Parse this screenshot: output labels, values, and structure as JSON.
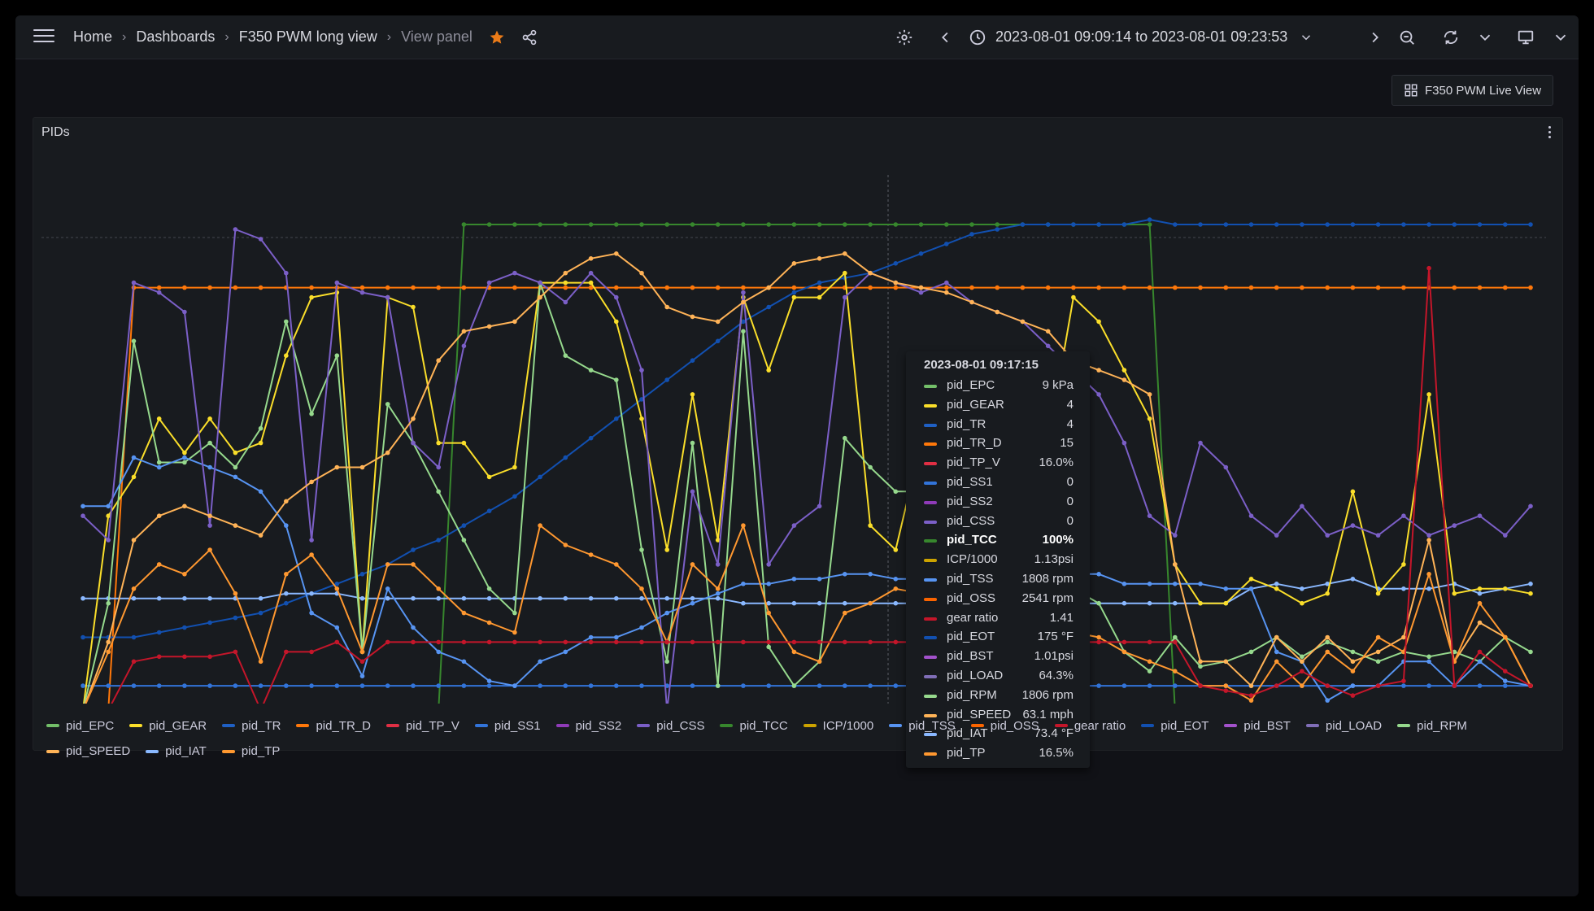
{
  "breadcrumb": [
    "Home",
    "Dashboards",
    "F350 PWM long view",
    "View panel"
  ],
  "time_range": "2023-08-01 09:09:14 to 2023-08-01 09:23:53",
  "link_button": "F350 PWM Live View",
  "panel": {
    "title": "PIDs"
  },
  "icons": {
    "menu": "hamburger-menu-icon",
    "star": "star-icon",
    "share": "share-icon",
    "settings": "gear-icon",
    "prev": "chevron-left-icon",
    "clock": "clock-icon",
    "next": "chevron-right-icon",
    "zoom_out": "zoom-out-icon",
    "refresh": "refresh-icon",
    "view_mode": "monitor-icon",
    "panel_menu": "kebab-menu-icon",
    "dashboard": "dashboard-grid-icon"
  },
  "colors": {
    "favorite": "#eb7b18",
    "background": "#111217",
    "panel": "#181b1f"
  },
  "tooltip": {
    "time": "2023-08-01 09:17:15",
    "rows": [
      {
        "name": "pid_EPC",
        "value": "9 kPa",
        "color": "#73bf69"
      },
      {
        "name": "pid_GEAR",
        "value": "4",
        "color": "#fade2a"
      },
      {
        "name": "pid_TR",
        "value": "4",
        "color": "#1f60c4"
      },
      {
        "name": "pid_TR_D",
        "value": "15",
        "color": "#ff780a"
      },
      {
        "name": "pid_TP_V",
        "value": "16.0%",
        "color": "#e02f44"
      },
      {
        "name": "pid_SS1",
        "value": "0",
        "color": "#3274d9"
      },
      {
        "name": "pid_SS2",
        "value": "0",
        "color": "#8f3bb8"
      },
      {
        "name": "pid_CSS",
        "value": "0",
        "color": "#7b5fc7"
      },
      {
        "name": "pid_TCC",
        "value": "100%",
        "color": "#37872d",
        "bold": true
      },
      {
        "name": "ICP/1000",
        "value": "1.13psi",
        "color": "#cca300"
      },
      {
        "name": "pid_TSS",
        "value": "1808 rpm",
        "color": "#5794f2"
      },
      {
        "name": "pid_OSS",
        "value": "2541 rpm",
        "color": "#fa6400"
      },
      {
        "name": "gear ratio",
        "value": "1.41",
        "color": "#c4162a"
      },
      {
        "name": "pid_EOT",
        "value": "175 °F",
        "color": "#1250b0"
      },
      {
        "name": "pid_BST",
        "value": "1.01psi",
        "color": "#a352cc"
      },
      {
        "name": "pid_LOAD",
        "value": "64.3%",
        "color": "#806eb7"
      },
      {
        "name": "pid_RPM",
        "value": "1806 rpm",
        "color": "#96d98d"
      },
      {
        "name": "pid_SPEED",
        "value": "63.1 mph",
        "color": "#ffb357"
      },
      {
        "name": "pid_IAT",
        "value": "73.4 °F",
        "color": "#8ab8ff"
      },
      {
        "name": "pid_TP",
        "value": "16.5%",
        "color": "#ff9830"
      }
    ]
  },
  "legend": [
    {
      "name": "pid_EPC",
      "color": "#73bf69"
    },
    {
      "name": "pid_GEAR",
      "color": "#fade2a"
    },
    {
      "name": "pid_TR",
      "color": "#1f60c4"
    },
    {
      "name": "pid_TR_D",
      "color": "#ff780a"
    },
    {
      "name": "pid_TP_V",
      "color": "#e02f44"
    },
    {
      "name": "pid_SS1",
      "color": "#3274d9"
    },
    {
      "name": "pid_SS2",
      "color": "#8f3bb8"
    },
    {
      "name": "pid_CSS",
      "color": "#7b5fc7"
    },
    {
      "name": "pid_TCC",
      "color": "#37872d"
    },
    {
      "name": "ICP/1000",
      "color": "#cca300"
    },
    {
      "name": "pid_TSS",
      "color": "#5794f2"
    },
    {
      "name": "pid_OSS",
      "color": "#fa6400"
    },
    {
      "name": "gear ratio",
      "color": "#c4162a"
    },
    {
      "name": "pid_EOT",
      "color": "#1250b0"
    },
    {
      "name": "pid_BST",
      "color": "#a352cc"
    },
    {
      "name": "pid_LOAD",
      "color": "#806eb7"
    },
    {
      "name": "pid_RPM",
      "color": "#96d98d"
    },
    {
      "name": "pid_SPEED",
      "color": "#ffb357"
    },
    {
      "name": "pid_IAT",
      "color": "#8ab8ff"
    },
    {
      "name": "pid_TP",
      "color": "#ff9830"
    }
  ],
  "chart_data": {
    "type": "line",
    "title": "PIDs",
    "x_time_range": [
      "2023-08-01 09:09:14",
      "2023-08-01 09:23:53"
    ],
    "ylim": [
      0,
      1
    ],
    "grid": false,
    "legend_position": "bottom",
    "hover_time": "2023-08-01 09:17:15",
    "series": [
      {
        "name": "pid_TCC",
        "color": "#37872d",
        "values": [
          0,
          0,
          0,
          0,
          0,
          0,
          0,
          0,
          0,
          0,
          0,
          0,
          0,
          0,
          0,
          1,
          1,
          1,
          1,
          1,
          1,
          1,
          1,
          1,
          1,
          1,
          1,
          1,
          1,
          1,
          1,
          1,
          1,
          1,
          1,
          1,
          1,
          1,
          1,
          1,
          1,
          1,
          1,
          0,
          0,
          0,
          0,
          0,
          0,
          0,
          0,
          0,
          0,
          0,
          0,
          0,
          0,
          0
        ]
      },
      {
        "name": "pid_TR_D",
        "color": "#ff780a",
        "values": [
          0,
          0,
          0.87,
          0.87,
          0.87,
          0.87,
          0.87,
          0.87,
          0.87,
          0.87,
          0.87,
          0.87,
          0.87,
          0.87,
          0.87,
          0.87,
          0.87,
          0.87,
          0.87,
          0.87,
          0.87,
          0.87,
          0.87,
          0.87,
          0.87,
          0.87,
          0.87,
          0.87,
          0.87,
          0.87,
          0.87,
          0.87,
          0.87,
          0.87,
          0.87,
          0.87,
          0.87,
          0.87,
          0.87,
          0.87,
          0.87,
          0.87,
          0.87,
          0.87,
          0.87,
          0.87,
          0.87,
          0.87,
          0.87,
          0.87,
          0.87,
          0.87,
          0.87,
          0.87,
          0.87,
          0.87,
          0.87,
          0.87
        ]
      },
      {
        "name": "pid_EOT",
        "color": "#1250b0",
        "values": [
          0.15,
          0.15,
          0.15,
          0.16,
          0.17,
          0.18,
          0.19,
          0.2,
          0.22,
          0.24,
          0.26,
          0.28,
          0.3,
          0.33,
          0.35,
          0.38,
          0.41,
          0.44,
          0.48,
          0.52,
          0.56,
          0.6,
          0.64,
          0.68,
          0.72,
          0.76,
          0.8,
          0.83,
          0.86,
          0.88,
          0.89,
          0.9,
          0.92,
          0.94,
          0.96,
          0.98,
          0.99,
          1,
          1,
          1,
          1,
          1,
          1.01,
          1,
          1,
          1,
          1,
          1,
          1,
          1,
          1,
          1,
          1,
          1,
          1,
          1,
          1,
          1
        ]
      },
      {
        "name": "pid_SS1",
        "color": "#3274d9",
        "values": [
          0.05,
          0.05,
          0.05,
          0.05,
          0.05,
          0.05,
          0.05,
          0.05,
          0.05,
          0.05,
          0.05,
          0.05,
          0.05,
          0.05,
          0.05,
          0.05,
          0.05,
          0.05,
          0.05,
          0.05,
          0.05,
          0.05,
          0.05,
          0.05,
          0.05,
          0.05,
          0.05,
          0.05,
          0.05,
          0.05,
          0.05,
          0.05,
          0.05,
          0.05,
          0.05,
          0.05,
          0.05,
          0.05,
          0.05,
          0.05,
          0.05,
          0.05,
          0.05,
          0.05,
          0.05,
          0.05,
          0.05,
          0.05,
          0.05,
          0.05,
          0.05,
          0.05,
          0.05,
          0.05,
          0.05,
          0.05,
          0.05,
          0.05
        ]
      },
      {
        "name": "pid_IAT",
        "color": "#8ab8ff",
        "values": [
          0.23,
          0.23,
          0.23,
          0.23,
          0.23,
          0.23,
          0.23,
          0.23,
          0.24,
          0.24,
          0.24,
          0.23,
          0.23,
          0.23,
          0.23,
          0.23,
          0.23,
          0.23,
          0.23,
          0.23,
          0.23,
          0.23,
          0.23,
          0.23,
          0.23,
          0.23,
          0.22,
          0.22,
          0.22,
          0.22,
          0.22,
          0.22,
          0.22,
          0.22,
          0.22,
          0.22,
          0.22,
          0.22,
          0.22,
          0.22,
          0.22,
          0.22,
          0.22,
          0.22,
          0.22,
          0.22,
          0.25,
          0.26,
          0.25,
          0.26,
          0.27,
          0.25,
          0.25,
          0.25,
          0.26,
          0.24,
          0.25,
          0.26
        ]
      },
      {
        "name": "pid_GEAR",
        "color": "#fade2a",
        "values": [
          0,
          0.4,
          0.48,
          0.6,
          0.53,
          0.6,
          0.53,
          0.55,
          0.73,
          0.85,
          0.86,
          0.12,
          0.85,
          0.83,
          0.55,
          0.55,
          0.48,
          0.5,
          0.88,
          0.88,
          0.88,
          0.8,
          0.6,
          0.33,
          0.65,
          0.35,
          0.85,
          0.7,
          0.85,
          0.85,
          0.9,
          0.38,
          0.33,
          0.55,
          0.5,
          0.6,
          0.5,
          0.5,
          0.55,
          0.85,
          0.8,
          0.7,
          0.6,
          0.3,
          0.22,
          0.22,
          0.27,
          0.25,
          0.22,
          0.24,
          0.45,
          0.24,
          0.3,
          0.65,
          0.24,
          0.25,
          0.25,
          0.24
        ]
      },
      {
        "name": "pid_RPM",
        "color": "#96d98d",
        "values": [
          0,
          0.22,
          0.76,
          0.51,
          0.51,
          0.55,
          0.5,
          0.58,
          0.8,
          0.61,
          0.73,
          0.12,
          0.63,
          0.55,
          0.45,
          0.35,
          0.25,
          0.2,
          0.88,
          0.73,
          0.7,
          0.68,
          0.33,
          0.1,
          0.55,
          0.05,
          0.78,
          0.13,
          0.05,
          0.1,
          0.56,
          0.5,
          0.45,
          0.45,
          0.4,
          0.38,
          0.38,
          0.32,
          0.28,
          0.25,
          0.22,
          0.12,
          0.08,
          0.15,
          0.09,
          0.1,
          0.12,
          0.15,
          0.11,
          0.14,
          0.12,
          0.1,
          0.12,
          0.11,
          0.12,
          0.1,
          0.15,
          0.12
        ]
      },
      {
        "name": "pid_TSS",
        "color": "#5794f2",
        "values": [
          0.42,
          0.42,
          0.52,
          0.5,
          0.52,
          0.5,
          0.48,
          0.45,
          0.38,
          0.2,
          0.17,
          0.07,
          0.25,
          0.17,
          0.12,
          0.1,
          0.06,
          0.05,
          0.1,
          0.12,
          0.15,
          0.15,
          0.17,
          0.2,
          0.22,
          0.24,
          0.26,
          0.26,
          0.27,
          0.27,
          0.28,
          0.28,
          0.27,
          0.27,
          0.27,
          0.27,
          0.27,
          0.28,
          0.28,
          0.28,
          0.28,
          0.26,
          0.26,
          0.26,
          0.26,
          0.25,
          0.25,
          0.12,
          0.1,
          0.02,
          0.05,
          0.05,
          0.1,
          0.1,
          0.05,
          0.1,
          0.06,
          0.05
        ]
      },
      {
        "name": "pid_LOAD",
        "color": "#7b5fc7",
        "values": [
          0.4,
          0.35,
          0.88,
          0.86,
          0.82,
          0.38,
          0.99,
          0.97,
          0.9,
          0.35,
          0.88,
          0.86,
          0.85,
          0.55,
          0.5,
          0.75,
          0.88,
          0.9,
          0.88,
          0.84,
          0.9,
          0.85,
          0.7,
          0,
          0.45,
          0.3,
          0.86,
          0.3,
          0.38,
          0.42,
          0.85,
          0.9,
          0.88,
          0.86,
          0.88,
          0.84,
          0.82,
          0.8,
          0.75,
          0.7,
          0.65,
          0.55,
          0.4,
          0.36,
          0.55,
          0.5,
          0.4,
          0.36,
          0.42,
          0.36,
          0.38,
          0.36,
          0.4,
          0.36,
          0.38,
          0.4,
          0.36,
          0.42
        ]
      },
      {
        "name": "pid_SPEED",
        "color": "#ffb357",
        "values": [
          0,
          0.14,
          0.35,
          0.4,
          0.42,
          0.4,
          0.38,
          0.36,
          0.43,
          0.47,
          0.5,
          0.5,
          0.53,
          0.6,
          0.72,
          0.78,
          0.79,
          0.8,
          0.85,
          0.9,
          0.93,
          0.94,
          0.9,
          0.83,
          0.81,
          0.8,
          0.84,
          0.87,
          0.92,
          0.93,
          0.94,
          0.9,
          0.88,
          0.87,
          0.86,
          0.84,
          0.82,
          0.8,
          0.78,
          0.72,
          0.7,
          0.68,
          0.65,
          0.3,
          0.1,
          0.1,
          0.05,
          0.15,
          0.1,
          0.15,
          0.1,
          0.12,
          0.15,
          0.35,
          0.1,
          0.18,
          0.15,
          0.05
        ]
      },
      {
        "name": "pid_TP",
        "color": "#ff9830",
        "values": [
          0,
          0.12,
          0.25,
          0.3,
          0.28,
          0.33,
          0.24,
          0.1,
          0.28,
          0.32,
          0.25,
          0.12,
          0.3,
          0.3,
          0.25,
          0.2,
          0.18,
          0.16,
          0.38,
          0.34,
          0.32,
          0.3,
          0.25,
          0.14,
          0.3,
          0.25,
          0.38,
          0.2,
          0.12,
          0.1,
          0.2,
          0.22,
          0.25,
          0.24,
          0.25,
          0.22,
          0.2,
          0.2,
          0.18,
          0.16,
          0.15,
          0.12,
          0.1,
          0.08,
          0.05,
          0.05,
          0.02,
          0.1,
          0.05,
          0.12,
          0.08,
          0.15,
          0.12,
          0.28,
          0.1,
          0.22,
          0.15,
          0.05
        ]
      },
      {
        "name": "gear ratio",
        "color": "#c4162a",
        "values": [
          0,
          0,
          0.1,
          0.11,
          0.11,
          0.11,
          0.12,
          0,
          0.12,
          0.12,
          0.14,
          0.1,
          0.14,
          0.14,
          0.14,
          0.14,
          0.14,
          0.14,
          0.14,
          0.14,
          0.14,
          0.14,
          0.14,
          0.14,
          0.14,
          0.14,
          0.14,
          0.14,
          0.14,
          0.14,
          0.14,
          0.14,
          0.14,
          0.14,
          0.14,
          0.14,
          0.14,
          0.14,
          0.14,
          0.14,
          0.14,
          0.14,
          0.14,
          0.14,
          0.05,
          0.04,
          0.03,
          0.05,
          0.08,
          0.05,
          0.03,
          0.05,
          0.06,
          0.91,
          0.05,
          0.12,
          0.08,
          0.05
        ]
      }
    ]
  }
}
